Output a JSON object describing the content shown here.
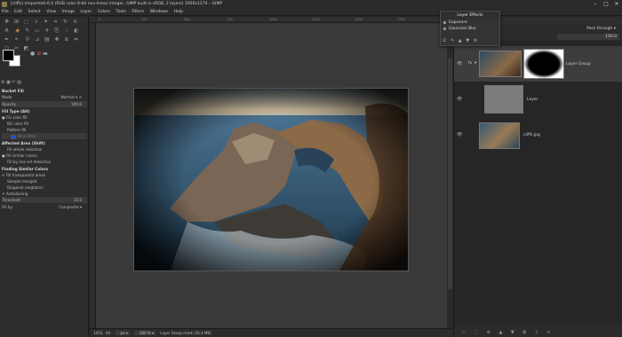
{
  "window": {
    "title": "[cliffs] (imported)-6.0 (RGB color 8-bit non-linear integer, GIMP built-in sRGB, 2 layers) 1920x1274 – GIMP",
    "controls": [
      "–",
      "□",
      "✕"
    ]
  },
  "menu": [
    "File",
    "Edit",
    "Select",
    "View",
    "Image",
    "Layer",
    "Colors",
    "Tools",
    "Filters",
    "Windows",
    "Help"
  ],
  "tool_options": {
    "title": "Bucket Fill",
    "mode_label": "Mode",
    "mode_value": "Normal",
    "opacity_label": "Opacity",
    "opacity_value": "100.0",
    "fill_type_head": "Fill Type  (Alt)",
    "fill_fg": "FG color fill",
    "fill_bg": "BG color fill",
    "fill_pattern": "Pattern fill",
    "pattern_name": "Blue Web",
    "affected_head": "Affected Area  (Shift)",
    "fill_whole": "Fill whole selection",
    "fill_similar": "Fill similar colors",
    "fill_lineart": "Fill by line art detection",
    "finding_head": "Finding Similar Colors",
    "fill_transparent": "Fill transparent areas",
    "sample_merged": "Sample merged",
    "diagonal": "Diagonal neighbors",
    "antialiasing": "Antialiasing",
    "threshold_label": "Threshold",
    "threshold_value": "15.0",
    "fillby_label": "Fill by",
    "fillby_value": "Composite"
  },
  "ruler_ticks": [
    "0",
    "250",
    "500",
    "750",
    "1000",
    "1250",
    "1500",
    "1750",
    "2000"
  ],
  "status": {
    "coords": "1455, -40",
    "unit": "px",
    "zoom": "100 %",
    "message": "Layer Group mask (30.4 MB)"
  },
  "layer_effects": {
    "title": "Layer Effects",
    "items": [
      "Exposure",
      "Gaussian Blur"
    ],
    "button_icons": [
      "☑",
      "✎",
      "▲",
      "▼",
      "⚙"
    ]
  },
  "layers_panel": {
    "mode_value": "Pass through",
    "opacity_value": "100.0",
    "layers": [
      {
        "name": "Layer Group",
        "visible": true,
        "selected": true
      },
      {
        "name": "Layer",
        "visible": true,
        "selected": false
      },
      {
        "name": "cliffs.jpg",
        "visible": true,
        "selected": false
      }
    ],
    "bottom_icons": [
      "▭",
      "⬚",
      "⊕",
      "▲",
      "▼",
      "⧉",
      "⇩",
      "✕"
    ]
  },
  "colors": {
    "background": "#262626",
    "panel": "#2d2d2d",
    "accent": "#e8a33c"
  }
}
